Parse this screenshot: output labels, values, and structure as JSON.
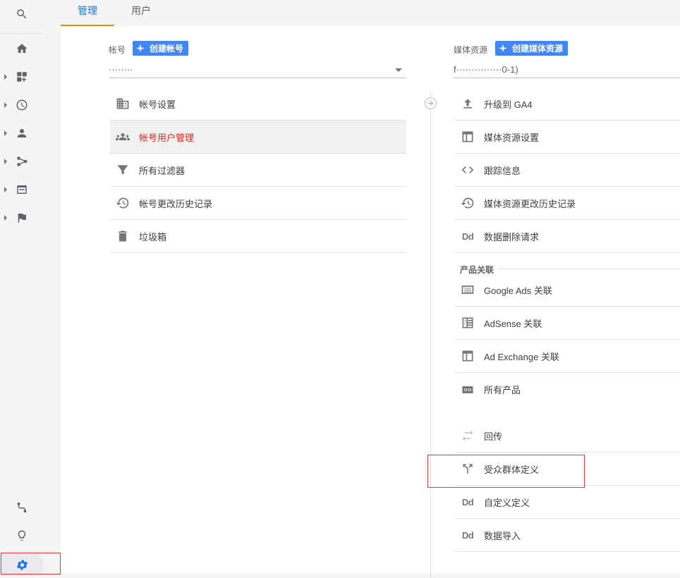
{
  "tabs": [
    {
      "label": "管理",
      "active": true
    },
    {
      "label": "用户",
      "active": false
    }
  ],
  "account_column": {
    "label": "帐号",
    "create_button": "创建帐号",
    "selected_value": "········",
    "items": [
      {
        "label": "帐号设置",
        "icon": "building-icon"
      },
      {
        "label": "帐号用户管理",
        "icon": "people-icon",
        "active": true
      },
      {
        "label": "所有过滤器",
        "icon": "filter-icon"
      },
      {
        "label": "帐号更改历史记录",
        "icon": "history-icon"
      },
      {
        "label": "垃圾箱",
        "icon": "trash-icon"
      }
    ]
  },
  "property_column": {
    "label": "媒体资源",
    "create_button": "创建媒体资源",
    "selected_value": "f···············0-1)",
    "items": [
      {
        "label": "升级到 GA4",
        "icon": "upload-icon"
      },
      {
        "label": "媒体资源设置",
        "icon": "window-icon"
      },
      {
        "label": "跟踪信息",
        "icon": "code-icon"
      },
      {
        "label": "媒体资源更改历史记录",
        "icon": "history-icon"
      },
      {
        "label": "数据删除请求",
        "icon": "dd-icon"
      }
    ],
    "product_links_title": "产品关联",
    "product_links": [
      {
        "label": "Google Ads 关联",
        "icon": "ads-icon"
      },
      {
        "label": "AdSense 关联",
        "icon": "adsense-icon"
      },
      {
        "label": "Ad Exchange 关联",
        "icon": "window-icon"
      },
      {
        "label": "所有产品",
        "icon": "link-icon"
      }
    ],
    "more_items": [
      {
        "label": "回传",
        "icon": "swap-icon"
      },
      {
        "label": "受众群体定义",
        "icon": "fork-icon"
      },
      {
        "label": "自定义定义",
        "icon": "dd-icon"
      },
      {
        "label": "数据导入",
        "icon": "dd-icon"
      }
    ]
  },
  "sidebar": {
    "items": [
      "search-icon",
      "home-icon",
      "dashboard-icon",
      "clock-icon",
      "person-icon",
      "acquisition-icon",
      "behavior-icon",
      "flag-icon"
    ],
    "bottom": [
      "route-icon",
      "lightbulb-icon",
      "gear-icon"
    ]
  },
  "colors": {
    "accent": "#1a73e8",
    "active_text": "#d93025",
    "tab_indicator": "#ef8a00",
    "button": "#4285f4",
    "highlight_box": "#e53935"
  }
}
